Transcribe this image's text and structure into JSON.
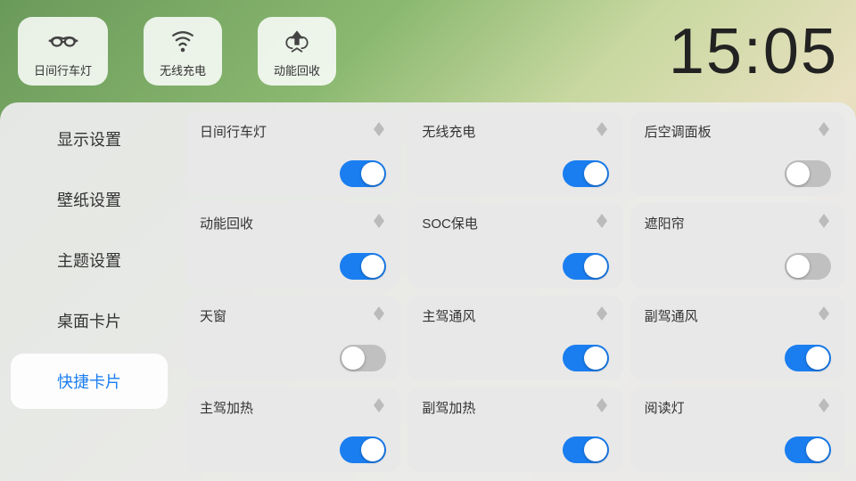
{
  "clock": "15:05",
  "topIcons": [
    {
      "id": "daytime-light",
      "label": "日间行车灯",
      "icon": "daytime"
    },
    {
      "id": "wireless-charge",
      "label": "无线充电",
      "icon": "wireless"
    },
    {
      "id": "energy-recycle",
      "label": "动能回收",
      "icon": "recycle"
    }
  ],
  "sidebar": {
    "items": [
      {
        "id": "display",
        "label": "显示设置",
        "active": false
      },
      {
        "id": "wallpaper",
        "label": "壁纸设置",
        "active": false
      },
      {
        "id": "theme",
        "label": "主题设置",
        "active": false
      },
      {
        "id": "desktop",
        "label": "桌面卡片",
        "active": false
      },
      {
        "id": "quick",
        "label": "快捷卡片",
        "active": true
      }
    ]
  },
  "cards": [
    {
      "id": "daytime-light",
      "title": "日间行车灯",
      "on": true
    },
    {
      "id": "wireless-charge",
      "title": "无线充电",
      "on": true
    },
    {
      "id": "rear-ac",
      "title": "后空调面板",
      "on": false
    },
    {
      "id": "energy-recycle",
      "title": "动能回收",
      "on": true
    },
    {
      "id": "soc-save",
      "title": "SOC保电",
      "on": true
    },
    {
      "id": "sunshade",
      "title": "遮阳帘",
      "on": false
    },
    {
      "id": "sunroof",
      "title": "天窗",
      "on": false
    },
    {
      "id": "driver-vent",
      "title": "主驾通风",
      "on": true
    },
    {
      "id": "passenger-vent",
      "title": "副驾通风",
      "on": true
    },
    {
      "id": "driver-heat",
      "title": "主驾加热",
      "on": true
    },
    {
      "id": "passenger-heat",
      "title": "副驾加热",
      "on": true
    },
    {
      "id": "reading-light",
      "title": "阅读灯",
      "on": true
    }
  ],
  "icons": {
    "sort": "↑↓"
  }
}
